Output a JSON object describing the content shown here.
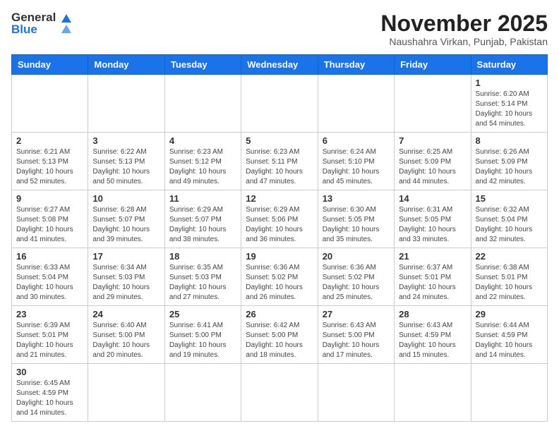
{
  "header": {
    "logo_text_general": "General",
    "logo_text_blue": "Blue",
    "month_title": "November 2025",
    "subtitle": "Naushahra Virkan, Punjab, Pakistan"
  },
  "weekdays": [
    "Sunday",
    "Monday",
    "Tuesday",
    "Wednesday",
    "Thursday",
    "Friday",
    "Saturday"
  ],
  "weeks": [
    [
      {
        "day": "",
        "info": ""
      },
      {
        "day": "",
        "info": ""
      },
      {
        "day": "",
        "info": ""
      },
      {
        "day": "",
        "info": ""
      },
      {
        "day": "",
        "info": ""
      },
      {
        "day": "",
        "info": ""
      },
      {
        "day": "1",
        "info": "Sunrise: 6:20 AM\nSunset: 5:14 PM\nDaylight: 10 hours\nand 54 minutes."
      }
    ],
    [
      {
        "day": "2",
        "info": "Sunrise: 6:21 AM\nSunset: 5:13 PM\nDaylight: 10 hours\nand 52 minutes."
      },
      {
        "day": "3",
        "info": "Sunrise: 6:22 AM\nSunset: 5:13 PM\nDaylight: 10 hours\nand 50 minutes."
      },
      {
        "day": "4",
        "info": "Sunrise: 6:23 AM\nSunset: 5:12 PM\nDaylight: 10 hours\nand 49 minutes."
      },
      {
        "day": "5",
        "info": "Sunrise: 6:23 AM\nSunset: 5:11 PM\nDaylight: 10 hours\nand 47 minutes."
      },
      {
        "day": "6",
        "info": "Sunrise: 6:24 AM\nSunset: 5:10 PM\nDaylight: 10 hours\nand 45 minutes."
      },
      {
        "day": "7",
        "info": "Sunrise: 6:25 AM\nSunset: 5:09 PM\nDaylight: 10 hours\nand 44 minutes."
      },
      {
        "day": "8",
        "info": "Sunrise: 6:26 AM\nSunset: 5:09 PM\nDaylight: 10 hours\nand 42 minutes."
      }
    ],
    [
      {
        "day": "9",
        "info": "Sunrise: 6:27 AM\nSunset: 5:08 PM\nDaylight: 10 hours\nand 41 minutes."
      },
      {
        "day": "10",
        "info": "Sunrise: 6:28 AM\nSunset: 5:07 PM\nDaylight: 10 hours\nand 39 minutes."
      },
      {
        "day": "11",
        "info": "Sunrise: 6:29 AM\nSunset: 5:07 PM\nDaylight: 10 hours\nand 38 minutes."
      },
      {
        "day": "12",
        "info": "Sunrise: 6:29 AM\nSunset: 5:06 PM\nDaylight: 10 hours\nand 36 minutes."
      },
      {
        "day": "13",
        "info": "Sunrise: 6:30 AM\nSunset: 5:05 PM\nDaylight: 10 hours\nand 35 minutes."
      },
      {
        "day": "14",
        "info": "Sunrise: 6:31 AM\nSunset: 5:05 PM\nDaylight: 10 hours\nand 33 minutes."
      },
      {
        "day": "15",
        "info": "Sunrise: 6:32 AM\nSunset: 5:04 PM\nDaylight: 10 hours\nand 32 minutes."
      }
    ],
    [
      {
        "day": "16",
        "info": "Sunrise: 6:33 AM\nSunset: 5:04 PM\nDaylight: 10 hours\nand 30 minutes."
      },
      {
        "day": "17",
        "info": "Sunrise: 6:34 AM\nSunset: 5:03 PM\nDaylight: 10 hours\nand 29 minutes."
      },
      {
        "day": "18",
        "info": "Sunrise: 6:35 AM\nSunset: 5:03 PM\nDaylight: 10 hours\nand 27 minutes."
      },
      {
        "day": "19",
        "info": "Sunrise: 6:36 AM\nSunset: 5:02 PM\nDaylight: 10 hours\nand 26 minutes."
      },
      {
        "day": "20",
        "info": "Sunrise: 6:36 AM\nSunset: 5:02 PM\nDaylight: 10 hours\nand 25 minutes."
      },
      {
        "day": "21",
        "info": "Sunrise: 6:37 AM\nSunset: 5:01 PM\nDaylight: 10 hours\nand 24 minutes."
      },
      {
        "day": "22",
        "info": "Sunrise: 6:38 AM\nSunset: 5:01 PM\nDaylight: 10 hours\nand 22 minutes."
      }
    ],
    [
      {
        "day": "23",
        "info": "Sunrise: 6:39 AM\nSunset: 5:01 PM\nDaylight: 10 hours\nand 21 minutes."
      },
      {
        "day": "24",
        "info": "Sunrise: 6:40 AM\nSunset: 5:00 PM\nDaylight: 10 hours\nand 20 minutes."
      },
      {
        "day": "25",
        "info": "Sunrise: 6:41 AM\nSunset: 5:00 PM\nDaylight: 10 hours\nand 19 minutes."
      },
      {
        "day": "26",
        "info": "Sunrise: 6:42 AM\nSunset: 5:00 PM\nDaylight: 10 hours\nand 18 minutes."
      },
      {
        "day": "27",
        "info": "Sunrise: 6:43 AM\nSunset: 5:00 PM\nDaylight: 10 hours\nand 17 minutes."
      },
      {
        "day": "28",
        "info": "Sunrise: 6:43 AM\nSunset: 4:59 PM\nDaylight: 10 hours\nand 15 minutes."
      },
      {
        "day": "29",
        "info": "Sunrise: 6:44 AM\nSunset: 4:59 PM\nDaylight: 10 hours\nand 14 minutes."
      }
    ],
    [
      {
        "day": "30",
        "info": "Sunrise: 6:45 AM\nSunset: 4:59 PM\nDaylight: 10 hours\nand 14 minutes."
      },
      {
        "day": "",
        "info": ""
      },
      {
        "day": "",
        "info": ""
      },
      {
        "day": "",
        "info": ""
      },
      {
        "day": "",
        "info": ""
      },
      {
        "day": "",
        "info": ""
      },
      {
        "day": "",
        "info": ""
      }
    ]
  ]
}
